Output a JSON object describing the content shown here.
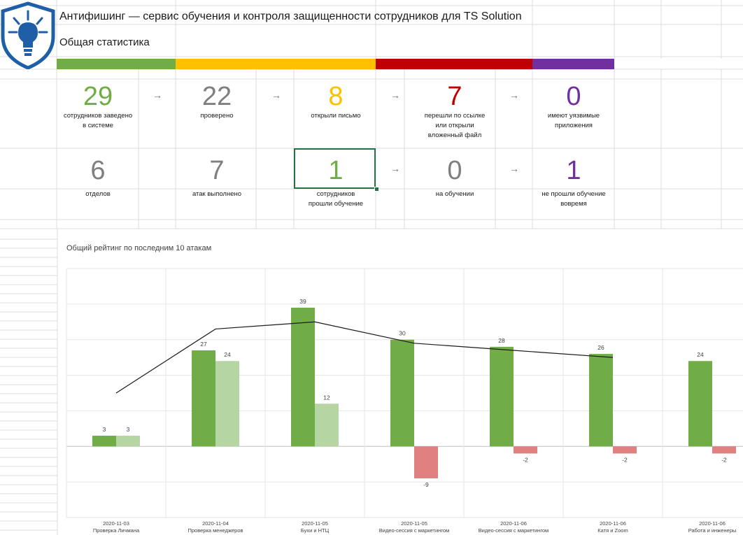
{
  "header": {
    "title": "Антифишинг — сервис обучения и контроля защищенности сотрудников для TS Solution",
    "subtitle": "Общая статистика"
  },
  "colors": {
    "green": "#70AD47",
    "light_green": "#B5D6A3",
    "yellow": "#FFC000",
    "red": "#C00000",
    "purple": "#7030A0",
    "gray": "#7F7F7F",
    "negative": "#E08080",
    "logo_blue": "#1F5FA8"
  },
  "kpi_row1": [
    {
      "value": "29",
      "label": "сотрудников заведено\nв системе"
    },
    {
      "value": "22",
      "label": "проверено"
    },
    {
      "value": "8",
      "label": "открыли письмо"
    },
    {
      "value": "7",
      "label": "перешли по ссылке\nили открыли\nвложенный файл"
    },
    {
      "value": "0",
      "label": "имеют уязвимые\nприложения"
    }
  ],
  "kpi_row2": [
    {
      "value": "6",
      "label": "отделов"
    },
    {
      "value": "7",
      "label": "атак выполнено"
    },
    {
      "value": "1",
      "label": "сотрудников\nпрошли обучение"
    },
    {
      "value": "0",
      "label": "на обучении"
    },
    {
      "value": "1",
      "label": "не прошли обучение\nвовремя"
    }
  ],
  "arrow_glyph": "→",
  "chart_data": {
    "type": "bar",
    "title": "Общий рейтинг по последним 10 атакам",
    "categories": [
      "2020-11-03\nПроверка Личмана",
      "2020-11-04\nПроверка менеджеров",
      "2020-11-05\nБухи и НТЦ",
      "2020-11-05\nВидео-сессия с маркетингом",
      "2020-11-06\nВидео-сессия с маркетингом",
      "2020-11-06\nКатя и Zoom",
      "2020-11-06\nРабота и инженеры"
    ],
    "series": [
      {
        "values": [
          3,
          27,
          39,
          30,
          28,
          26,
          24
        ],
        "labels": [
          "3",
          "27",
          "39",
          "30",
          "28",
          "26",
          "24"
        ]
      },
      {
        "values": [
          3,
          24,
          12,
          -9,
          -2,
          -2,
          -2
        ],
        "labels": [
          "3",
          "24",
          "12",
          "-9",
          "-2",
          "-2",
          "-2"
        ]
      }
    ],
    "line_series": {
      "values": [
        15,
        33,
        35,
        29,
        27,
        25
      ]
    },
    "ylim": [
      -20,
      50
    ],
    "grid": true
  }
}
